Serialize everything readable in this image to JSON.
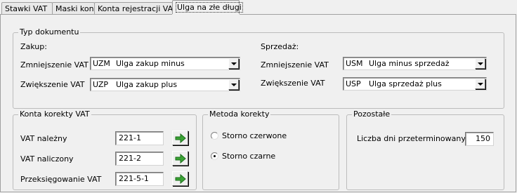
{
  "tabs": [
    {
      "label": "Stawki VAT"
    },
    {
      "label": "Maski kont"
    },
    {
      "label": "Konta rejestracji VAT"
    },
    {
      "label": "Ulga na złe długi"
    }
  ],
  "document_type": {
    "title": "Typ dokumentu",
    "purchase": {
      "heading": "Zakup:",
      "decrease_label": "Zmniejszenie VAT",
      "decrease_code": "UZM",
      "decrease_name": "Ulga zakup minus",
      "increase_label": "Zwiększenie VAT",
      "increase_code": "UZP",
      "increase_name": "Ulga zakup plus"
    },
    "sale": {
      "heading": "Sprzedaż:",
      "decrease_label": "Zmniejszenie VAT",
      "decrease_code": "USM",
      "decrease_name": "Ulga minus sprzedaż",
      "increase_label": "Zwiększenie VAT",
      "increase_code": "USP",
      "increase_name": "Ulga sprzedaż plus"
    }
  },
  "vat_accounts": {
    "title": "Konta korekty VAT",
    "rows": [
      {
        "label": "VAT należny",
        "value": "221-1"
      },
      {
        "label": "VAT naliczony",
        "value": "221-2"
      },
      {
        "label": "Przeksięgowanie VAT",
        "value": "221-5-1"
      }
    ]
  },
  "correction_method": {
    "title": "Metoda korekty",
    "options": [
      {
        "label": "Storno czerwone",
        "selected": false
      },
      {
        "label": "Storno czarne",
        "selected": true
      }
    ]
  },
  "other": {
    "title": "Pozostałe",
    "overdue_days_label": "Liczba dni przeterminowanych",
    "overdue_days_value": "150"
  },
  "icons": {
    "assign": "green-right-arrow-icon",
    "dropdown": "chevron-down-icon"
  },
  "colors": {
    "arrow_green": "#3aa335"
  }
}
